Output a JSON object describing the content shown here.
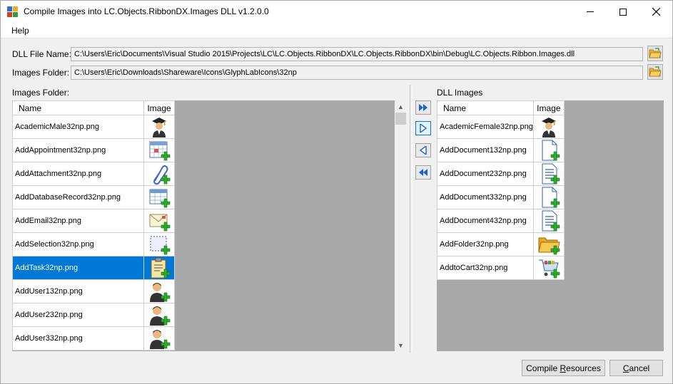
{
  "window": {
    "title": "Compile Images into LC.Objects.RibbonDX.Images DLL v1.2.0.0",
    "minimize_glyph": "—",
    "maximize_glyph": "☐",
    "close_glyph": "✕"
  },
  "menu": {
    "help": "Help"
  },
  "dll_file": {
    "label": "DLL File Name:",
    "value": "C:\\Users\\Eric\\Documents\\Visual Studio 2015\\Projects\\LC\\LC.Objects.RibbonDX\\LC.Objects.RibbonDX\\bin\\Debug\\LC.Objects.Ribbon.Images.dll"
  },
  "images_folder": {
    "label": "Images Folder:",
    "value": "C:\\Users\\Eric\\Downloads\\Shareware\\Icons\\GlyphLabIcons\\32np"
  },
  "left_panel": {
    "label": "Images Folder:",
    "columns": [
      "Name",
      "Image"
    ],
    "rows": [
      {
        "name": "AcademicMale32np.png",
        "icon": "academic-icon"
      },
      {
        "name": "AddAppointment32np.png",
        "icon": "calendar-add-icon"
      },
      {
        "name": "AddAttachment32np.png",
        "icon": "paperclip-add-icon"
      },
      {
        "name": "AddDatabaseRecord32np.png",
        "icon": "table-add-icon"
      },
      {
        "name": "AddEmail32np.png",
        "icon": "envelope-add-icon"
      },
      {
        "name": "AddSelection32np.png",
        "icon": "selection-add-icon"
      },
      {
        "name": "AddTask32np.png",
        "icon": "clipboard-add-icon",
        "selected": true
      },
      {
        "name": "AddUser132np.png",
        "icon": "user-add-icon"
      },
      {
        "name": "AddUser232np.png",
        "icon": "user-add-icon"
      },
      {
        "name": "AddUser332np.png",
        "icon": "user-add-icon"
      }
    ]
  },
  "right_panel": {
    "label": "DLL Images",
    "columns": [
      "Name",
      "Image"
    ],
    "rows": [
      {
        "name": "AcademicFemale32np.png",
        "icon": "academic-icon"
      },
      {
        "name": "AddDocument132np.png",
        "icon": "document-add-icon"
      },
      {
        "name": "AddDocument232np.png",
        "icon": "document-lines-add-icon"
      },
      {
        "name": "AddDocument332np.png",
        "icon": "document-add-icon"
      },
      {
        "name": "AddDocument432np.png",
        "icon": "document-lines-add-icon"
      },
      {
        "name": "AddFolder32np.png",
        "icon": "folder-add-icon"
      },
      {
        "name": "AddtoCart32np.png",
        "icon": "cart-add-icon"
      }
    ]
  },
  "buttons": {
    "compile_pre": "Compile ",
    "compile_u": "R",
    "compile_post": "esources",
    "cancel_u": "C",
    "cancel_post": "ancel"
  },
  "colors": {
    "selection": "#0078d7",
    "grid_background": "#a9a9a9",
    "accent_blue": "#1e5fcf"
  }
}
